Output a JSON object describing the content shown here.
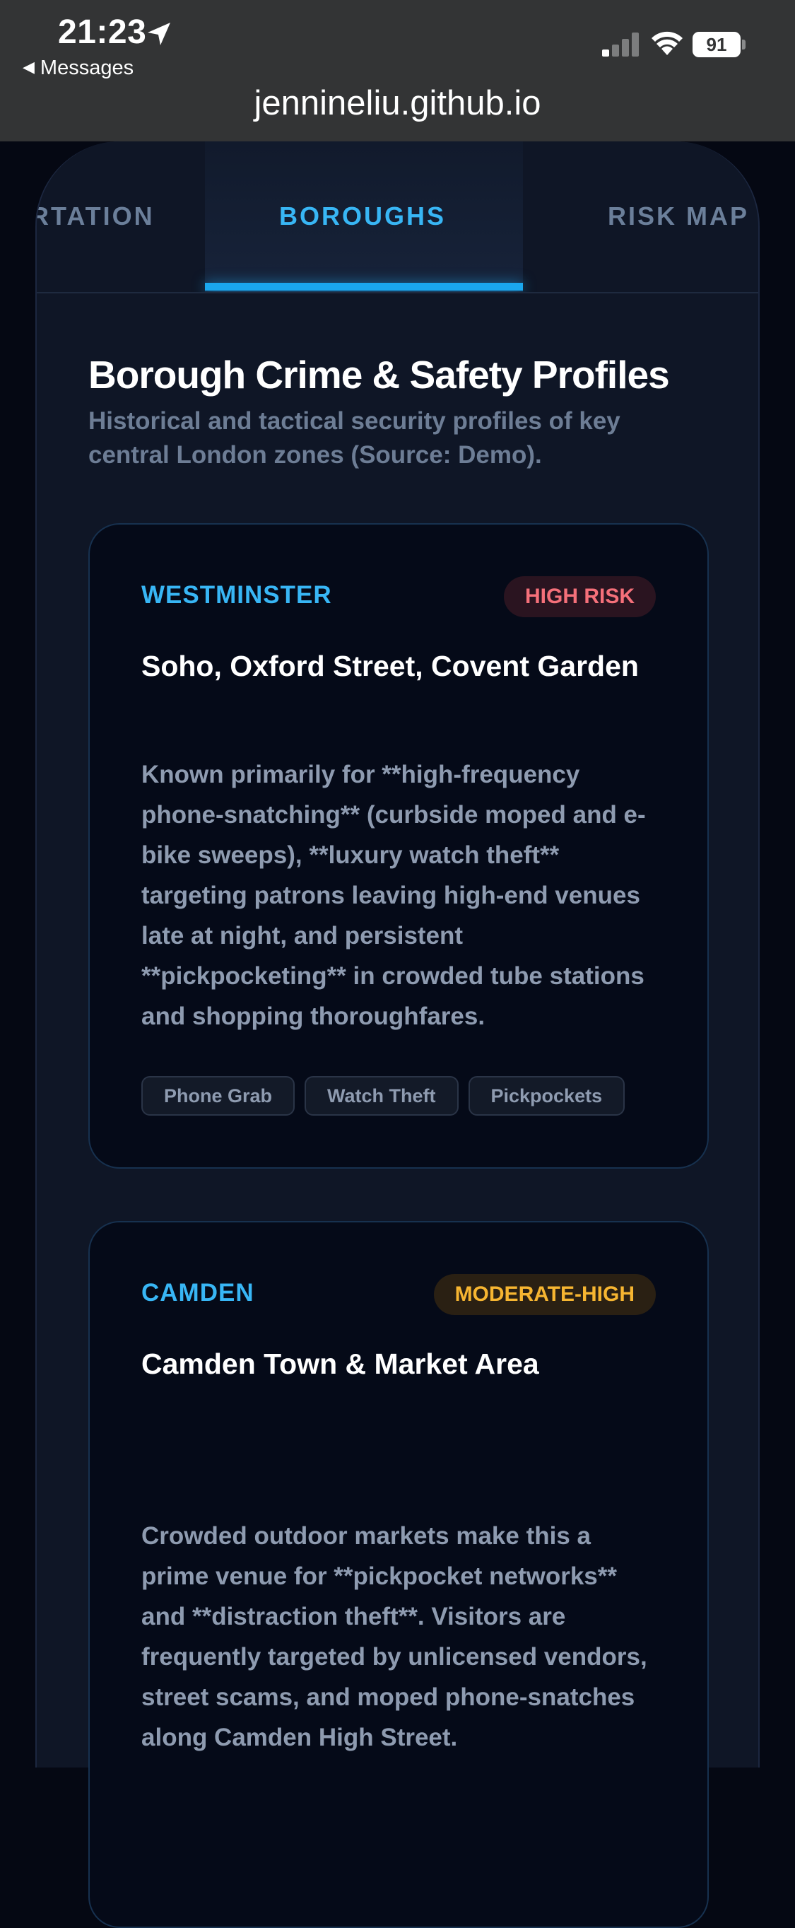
{
  "status_bar": {
    "time": "21:23",
    "back_label": "Messages",
    "battery": "91",
    "url": "jennineliu.github.io"
  },
  "tabs": [
    {
      "label": "TRANSPORTATION",
      "active": false
    },
    {
      "label": "BOROUGHS",
      "active": true
    },
    {
      "label": "RISK MAP",
      "active": false
    }
  ],
  "section": {
    "title": "Borough Crime & Safety Profiles",
    "subtitle": "Historical and tactical security profiles of key central London zones (Source: Demo)."
  },
  "boroughs": [
    {
      "name": "WESTMINSTER",
      "risk": "HIGH RISK",
      "risk_color": "#f5707a",
      "areas": "Soho, Oxford Street, Covent Garden",
      "description": "Known primarily for **high-frequency phone-snatching** (curbside moped and e-bike sweeps), **luxury watch theft** targeting patrons leaving high-end venues late at night, and persistent **pickpocketing** in crowded tube stations and shopping thoroughfares.",
      "tags": [
        "Phone Grab",
        "Watch Theft",
        "Pickpockets"
      ]
    },
    {
      "name": "CAMDEN",
      "risk": "MODERATE-HIGH",
      "risk_color": "#f6b531",
      "areas": "Camden Town & Market Area",
      "description": "Crowded outdoor markets make this a prime venue for **pickpocket networks** and **distraction theft**. Visitors are frequently targeted by unlicensed vendors, street scams, and moped phone-snatches along Camden High Street."
    }
  ],
  "colors": {
    "accent": "#38b6f5",
    "background": "#050813",
    "panel": "#0f1626"
  }
}
